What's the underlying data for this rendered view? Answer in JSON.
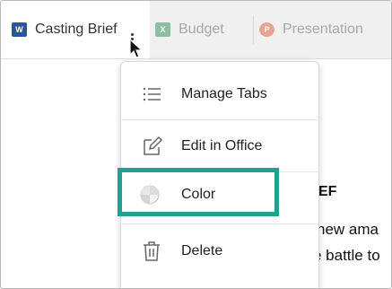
{
  "tabs": [
    {
      "label": "Casting Brief",
      "icon": "word-doc-icon",
      "active": true,
      "icon_letter": "W"
    },
    {
      "label": "Budget",
      "icon": "excel-doc-icon",
      "active": false,
      "icon_letter": "X"
    },
    {
      "label": "Presentation",
      "icon": "powerpoint-doc-icon",
      "active": false,
      "icon_letter": "P"
    }
  ],
  "menu": {
    "items": [
      {
        "label": "Manage Tabs",
        "icon": "list-icon"
      },
      {
        "label": "Edit in Office",
        "icon": "edit-icon"
      },
      {
        "label": "Color",
        "icon": "color-wheel-icon",
        "highlighted": true
      },
      {
        "label": "Delete",
        "icon": "trash-icon"
      }
    ]
  },
  "document": {
    "heading_fragment": "RIEF",
    "line1_fragment": "new ama",
    "line2_fragment": "e battle to"
  },
  "colors": {
    "highlight": "#21a08d",
    "word": "#2a5699"
  }
}
